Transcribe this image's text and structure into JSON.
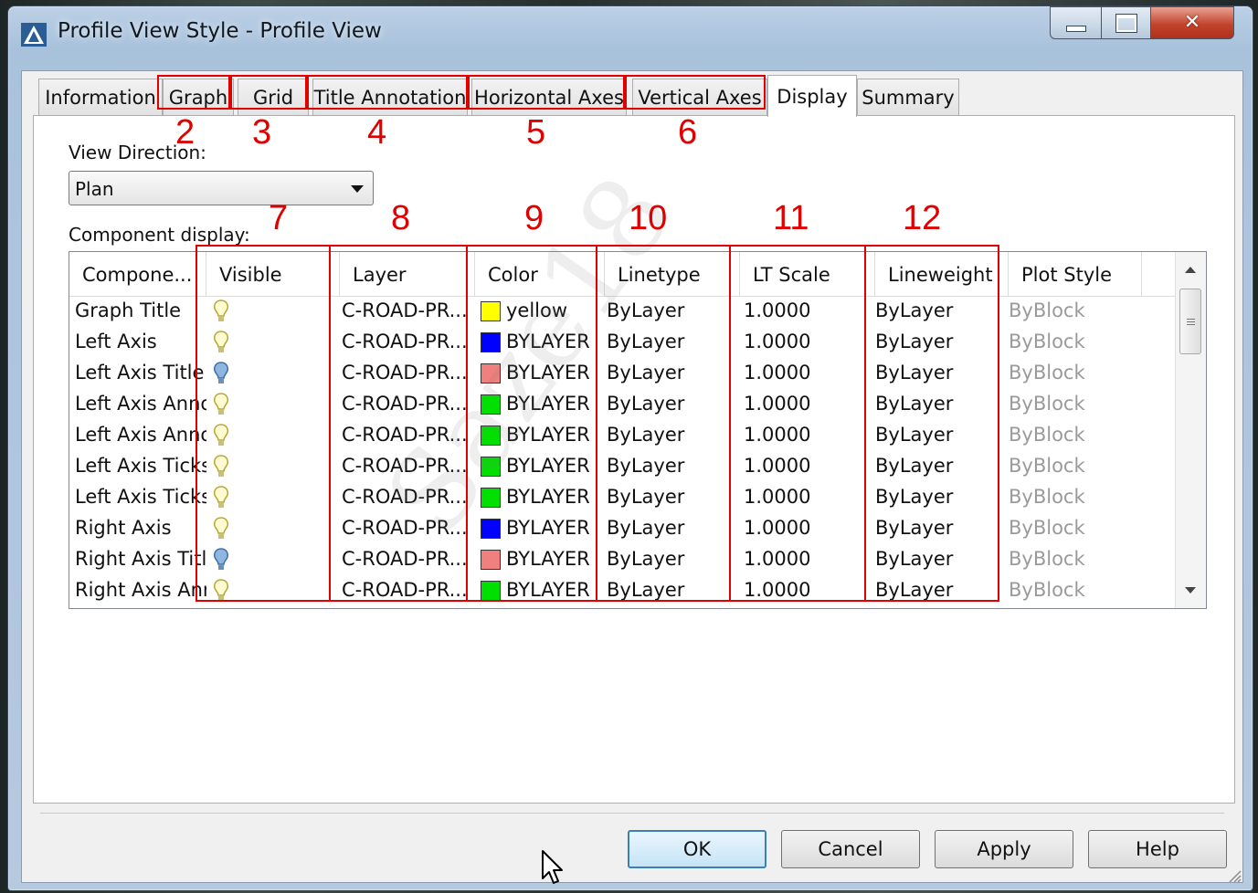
{
  "window": {
    "title": "Profile View Style - Profile View",
    "icon": "autocad-civil-icon"
  },
  "tabs": [
    {
      "label": "Information",
      "active": false
    },
    {
      "label": "Graph",
      "active": false
    },
    {
      "label": "Grid",
      "active": false
    },
    {
      "label": "Title Annotation",
      "active": false
    },
    {
      "label": "Horizontal Axes",
      "active": false
    },
    {
      "label": "Vertical Axes",
      "active": false
    },
    {
      "label": "Display",
      "active": true
    },
    {
      "label": "Summary",
      "active": false
    }
  ],
  "view_direction": {
    "label": "View Direction:",
    "value": "Plan"
  },
  "component_display": {
    "label": "Component display:",
    "columns": [
      "Compone...",
      "Visible",
      "Layer",
      "Color",
      "Linetype",
      "LT Scale",
      "Lineweight",
      "Plot Style"
    ],
    "rows": [
      {
        "component": "Graph Title",
        "visible": "on",
        "layer": "C-ROAD-PR...",
        "color_name": "yellow",
        "color_hex": "#ffff00",
        "linetype": "ByLayer",
        "lt_scale": "1.0000",
        "lineweight": "ByLayer",
        "plot_style": "ByBlock"
      },
      {
        "component": "Left Axis",
        "visible": "on",
        "layer": "C-ROAD-PR...",
        "color_name": "BYLAYER",
        "color_hex": "#0000ff",
        "linetype": "ByLayer",
        "lt_scale": "1.0000",
        "lineweight": "ByLayer",
        "plot_style": "ByBlock"
      },
      {
        "component": "Left Axis Title",
        "visible": "off",
        "layer": "C-ROAD-PR...",
        "color_name": "BYLAYER",
        "color_hex": "#f08080",
        "linetype": "ByLayer",
        "lt_scale": "1.0000",
        "lineweight": "ByLayer",
        "plot_style": "ByBlock"
      },
      {
        "component": "Left Axis Anno",
        "visible": "on",
        "layer": "C-ROAD-PR...",
        "color_name": "BYLAYER",
        "color_hex": "#00e000",
        "linetype": "ByLayer",
        "lt_scale": "1.0000",
        "lineweight": "ByLayer",
        "plot_style": "ByBlock"
      },
      {
        "component": "Left Axis Anno",
        "visible": "on",
        "layer": "C-ROAD-PR...",
        "color_name": "BYLAYER",
        "color_hex": "#00e000",
        "linetype": "ByLayer",
        "lt_scale": "1.0000",
        "lineweight": "ByLayer",
        "plot_style": "ByBlock"
      },
      {
        "component": "Left Axis Ticks",
        "visible": "on",
        "layer": "C-ROAD-PR...",
        "color_name": "BYLAYER",
        "color_hex": "#00e000",
        "linetype": "ByLayer",
        "lt_scale": "1.0000",
        "lineweight": "ByLayer",
        "plot_style": "ByBlock"
      },
      {
        "component": "Left Axis Ticks",
        "visible": "on",
        "layer": "C-ROAD-PR...",
        "color_name": "BYLAYER",
        "color_hex": "#00e000",
        "linetype": "ByLayer",
        "lt_scale": "1.0000",
        "lineweight": "ByLayer",
        "plot_style": "ByBlock"
      },
      {
        "component": "Right Axis",
        "visible": "on",
        "layer": "C-ROAD-PR...",
        "color_name": "BYLAYER",
        "color_hex": "#0000ff",
        "linetype": "ByLayer",
        "lt_scale": "1.0000",
        "lineweight": "ByLayer",
        "plot_style": "ByBlock"
      },
      {
        "component": "Right Axis Title",
        "visible": "off",
        "layer": "C-ROAD-PR...",
        "color_name": "BYLAYER",
        "color_hex": "#f08080",
        "linetype": "ByLayer",
        "lt_scale": "1.0000",
        "lineweight": "ByLayer",
        "plot_style": "ByBlock"
      },
      {
        "component": "Right Axis Ann",
        "visible": "on",
        "layer": "C-ROAD-PR...",
        "color_name": "BYLAYER",
        "color_hex": "#00e000",
        "linetype": "ByLayer",
        "lt_scale": "1.0000",
        "lineweight": "ByLayer",
        "plot_style": "ByBlock"
      }
    ]
  },
  "annotations": {
    "numbers": [
      "2",
      "3",
      "4",
      "5",
      "6",
      "7",
      "8",
      "9",
      "10",
      "11",
      "12"
    ],
    "color": "#e00000"
  },
  "buttons": {
    "ok": "OK",
    "cancel": "Cancel",
    "apply": "Apply",
    "help": "Help"
  },
  "watermark": "Saze18"
}
